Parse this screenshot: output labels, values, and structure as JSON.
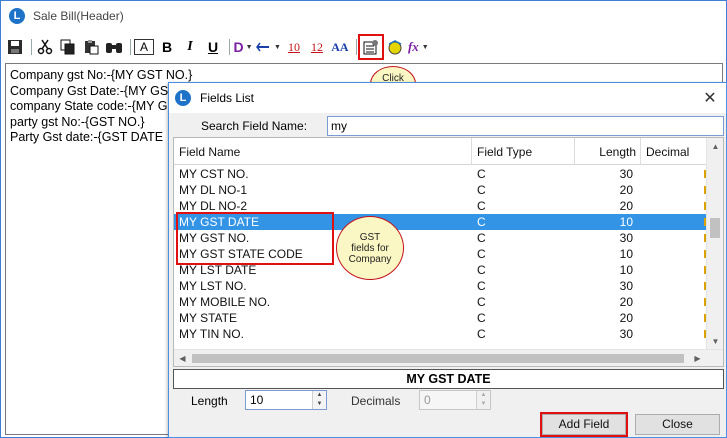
{
  "window": {
    "title": "Sale Bill(Header)"
  },
  "toolbar": {
    "items": [
      {
        "name": "save-icon",
        "label": ""
      },
      {
        "name": "cut-icon",
        "label": ""
      },
      {
        "name": "copy-icon",
        "label": ""
      },
      {
        "name": "paste-icon",
        "label": ""
      },
      {
        "name": "find-icon",
        "label": ""
      },
      {
        "name": "font-size-icon",
        "label": "A"
      },
      {
        "name": "bold-icon",
        "label": "B"
      },
      {
        "name": "italic-icon",
        "label": "I"
      },
      {
        "name": "underline-icon",
        "label": "U"
      },
      {
        "name": "d-menu-icon",
        "label": "D"
      },
      {
        "name": "indent-menu-icon",
        "label": ""
      },
      {
        "name": "size-10-icon",
        "label": "10"
      },
      {
        "name": "size-12-icon",
        "label": "12"
      },
      {
        "name": "font-icon",
        "label": "AA"
      },
      {
        "name": "field-list-icon",
        "label": ""
      },
      {
        "name": "image-icon",
        "label": ""
      },
      {
        "name": "function-icon",
        "label": "fx"
      }
    ]
  },
  "editor": {
    "lines": [
      "Company gst No:-{MY GST NO.}",
      "Company Gst Date:-{MY GS",
      "company State code:-{MY G",
      "party gst No:-{GST NO.}",
      "Party Gst date:-{GST DATE"
    ]
  },
  "callouts": {
    "click_here": "Click Here",
    "gst_fields": "GST fields for Company"
  },
  "dialog": {
    "title": "Fields List",
    "search_label": "Search Field Name:",
    "search_value": "my",
    "columns": [
      "Field Name",
      "Field Type",
      "Length",
      "Decimal"
    ],
    "rows": [
      {
        "name": "MY CST NO.",
        "type": "C",
        "length": "30"
      },
      {
        "name": "MY DL NO-1",
        "type": "C",
        "length": "20"
      },
      {
        "name": "MY DL NO-2",
        "type": "C",
        "length": "20"
      },
      {
        "name": "MY GST DATE",
        "type": "C",
        "length": "10"
      },
      {
        "name": "MY GST NO.",
        "type": "C",
        "length": "30"
      },
      {
        "name": "MY GST STATE CODE",
        "type": "C",
        "length": "10"
      },
      {
        "name": "MY LST DATE",
        "type": "C",
        "length": "10"
      },
      {
        "name": "MY LST NO.",
        "type": "C",
        "length": "30"
      },
      {
        "name": "MY MOBILE NO.",
        "type": "C",
        "length": "20"
      },
      {
        "name": "MY STATE",
        "type": "C",
        "length": "20"
      },
      {
        "name": "MY TIN NO.",
        "type": "C",
        "length": "30"
      }
    ],
    "selected_row": 3,
    "selected_field": "MY GST DATE",
    "length_label": "Length",
    "length_value": "10",
    "decimals_label": "Decimals",
    "decimals_value": "0",
    "add_button": "Add Field",
    "close_button": "Close"
  },
  "colors": {
    "selection": "#3394e6",
    "annotation_red": "#e01010",
    "callout_fill": "#fbf7c4"
  }
}
